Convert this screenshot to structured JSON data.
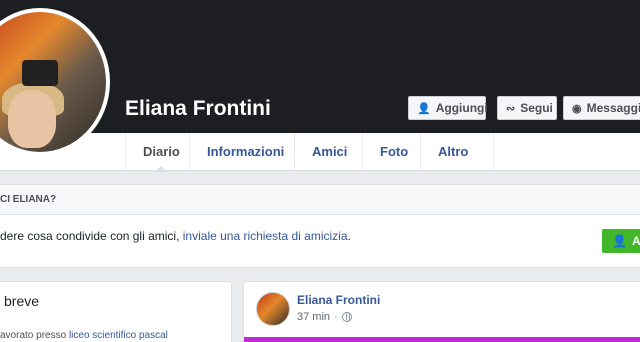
{
  "profile": {
    "name": "Eliana Frontini"
  },
  "cover_actions": {
    "add_friend": "Aggiungi",
    "follow": "Segui",
    "message": "Messaggio"
  },
  "tabs": [
    {
      "label": "Diario"
    },
    {
      "label": "Informazioni"
    },
    {
      "label": "Amici"
    },
    {
      "label": "Foto"
    },
    {
      "label": "Altro"
    }
  ],
  "friend_prompt": {
    "heading": "CI ELIANA?",
    "text_before": "dere cosa condivide con gli amici, ",
    "link": "inviale una richiesta di amicizia",
    "text_after": ".",
    "button": "Ag"
  },
  "intro": {
    "title": "breve",
    "line_before": "avorato presso ",
    "line_link": "liceo scientifico pascal"
  },
  "post": {
    "author": "Eliana Frontini",
    "time": "37 min",
    "banner_color": "#c12bd8"
  },
  "icons": {
    "add_friend": "add-friend-icon",
    "follow": "rss-icon",
    "message": "messenger-icon",
    "altro": "caret-down-icon",
    "privacy": "globe-icon"
  }
}
